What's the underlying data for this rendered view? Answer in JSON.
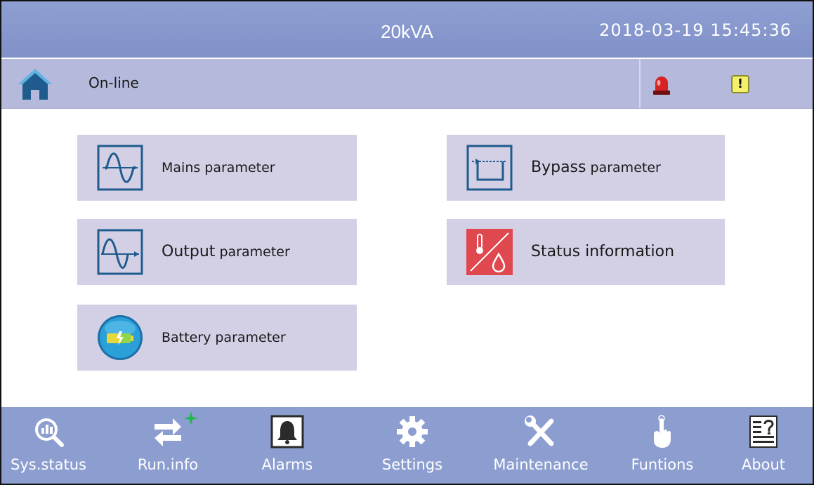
{
  "header": {
    "device": "20kVA",
    "datetime": "2018-03-19  15:45:36"
  },
  "status_bar": {
    "mode": "On-line",
    "home_icon": "home-icon",
    "alarm_icon": "alarm-light-icon",
    "warning_symbol": "!"
  },
  "menu": {
    "mains": {
      "label": "Mains parameter",
      "icon": "mains-waveform-icon"
    },
    "bypass": {
      "label_bold": "Bypass",
      "label_rest": " parameter",
      "icon": "bypass-icon"
    },
    "output": {
      "label_bold": "Output",
      "label_rest": " parameter",
      "icon": "output-waveform-icon"
    },
    "status": {
      "label": "Status information",
      "icon": "thermometer-humidity-icon"
    },
    "battery": {
      "label": "Battery parameter",
      "icon": "battery-icon"
    }
  },
  "nav": {
    "sys_status": "Sys.status",
    "run_info": "Run.info",
    "alarms": "Alarms",
    "settings": "Settings",
    "maintenance": "Maintenance",
    "functions": "Funtions",
    "about": "About"
  },
  "colors": {
    "top_bar": "#8191c9",
    "status_bar": "#b5b9dc",
    "menu_card": "#d3d0e6",
    "icon_stroke": "#1f5b8c",
    "status_icon_bg": "#e0484f",
    "battery_icon_bg": "#2a9fd8",
    "new_indicator": "#1fb84a",
    "warning_bg": "#f4f06c"
  }
}
